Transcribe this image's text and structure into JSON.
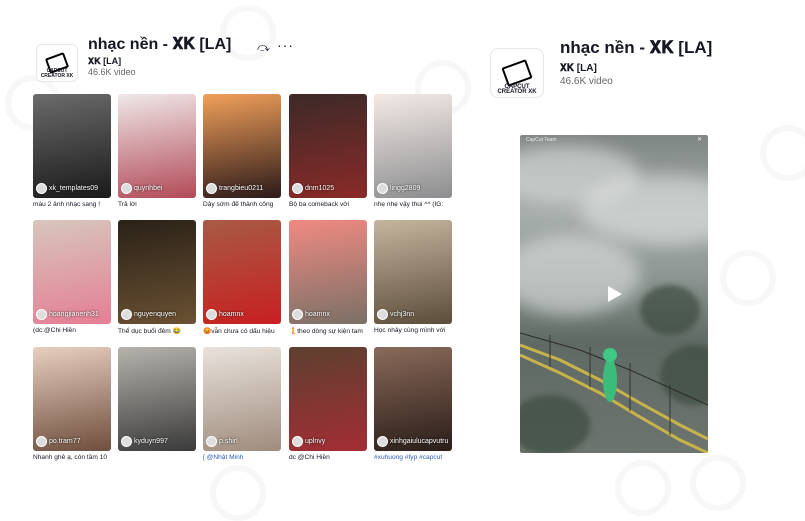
{
  "left": {
    "title": "nhạc nền - 𝐗𝐊 [LA]",
    "author": "𝐗𝐊 [LA]",
    "count": "46.6K video",
    "logo_text": "CAPCUT\nCREATOR XK",
    "share_icon": "share-icon",
    "more_icon": "more-icon",
    "more_glyph": "···",
    "share_glyph": "⤼"
  },
  "right": {
    "title": "nhạc nền - 𝐗𝐊 [LA]",
    "author": "𝐗𝐊 [LA]",
    "count": "46.6K video",
    "logo_text": "CAPCUT\nCREATOR XK",
    "video_top_label": "CapCut Team",
    "video_close": "✕"
  },
  "videos": [
    {
      "user": "xk_templates09",
      "caption": "mẫu 2 ảnh nhạc sang !",
      "caption_color": "#161823",
      "bg": [
        "#6b6b6b",
        "#1a1a1a"
      ]
    },
    {
      "user": "quynhbei",
      "caption": "Trả lời",
      "caption_color": "#161823",
      "bg": [
        "#efe8e8",
        "#b24a58"
      ]
    },
    {
      "user": "trangbieu0211",
      "caption": "Dậy sớm để thành công",
      "caption_color": "#161823",
      "bg": [
        "#f2a05a",
        "#2b1a1a"
      ]
    },
    {
      "user": "dnm1025",
      "caption": "Bộ ba comeback với",
      "caption_color": "#161823",
      "bg": [
        "#3c2a28",
        "#8a2a28"
      ]
    },
    {
      "user": "lingg2809",
      "caption": "nhẹ nhẹ vậy thui ^^ (IG:",
      "caption_color": "#161823",
      "bg": [
        "#f3eae6",
        "#8c8d8f"
      ]
    },
    {
      "user": "hoangjianenh31",
      "caption": "(dc:@Chi Hiền",
      "caption_color": "#161823",
      "bg": [
        "#d7c6bc",
        "#e47e94"
      ]
    },
    {
      "user": "nguyenquyen",
      "caption": "Thể dục buổi đêm 😂",
      "caption_color": "#161823",
      "bg": [
        "#2a2118",
        "#6a5132"
      ]
    },
    {
      "user": "hoamnx",
      "caption": "😡vẫn chưa có dấu hiệu",
      "caption_color": "#161823",
      "bg": [
        "#a85a45",
        "#c82020"
      ]
    },
    {
      "user": "hoamnx",
      "caption": "🧜theo dòng sự kiện tam",
      "caption_color": "#161823",
      "bg": [
        "#f08a82",
        "#7a7066"
      ]
    },
    {
      "user": "vchj3nn",
      "caption": "Học nhảy cùng mình với",
      "caption_color": "#161823",
      "bg": [
        "#c5b59f",
        "#5c4d3a"
      ]
    },
    {
      "user": "po.tram77",
      "caption": "Nhanh ghê ạ, còn tầm 10",
      "caption_color": "#161823",
      "bg": [
        "#e8cfc0",
        "#6f4e3d"
      ]
    },
    {
      "user": "kyduyn997",
      "caption": "",
      "caption_color": "#161823",
      "bg": [
        "#b6b3ad",
        "#3a3a3a"
      ]
    },
    {
      "user": "p.shirl",
      "caption": "[ @Nhật Minh",
      "caption_color": "#2b5db9",
      "bg": [
        "#e9e2dc",
        "#9f8c7d"
      ]
    },
    {
      "user": "uplnvy",
      "caption": "dc @Chi Hiền",
      "caption_color": "#161823",
      "bg": [
        "#5d4030",
        "#a32d35"
      ]
    },
    {
      "user": "xinhgaiulucapvutru",
      "caption": "#xuhuong #fyp #capcut",
      "caption_color": "#2b5db9",
      "bg": [
        "#8a6a5a",
        "#2a1d18"
      ]
    }
  ]
}
